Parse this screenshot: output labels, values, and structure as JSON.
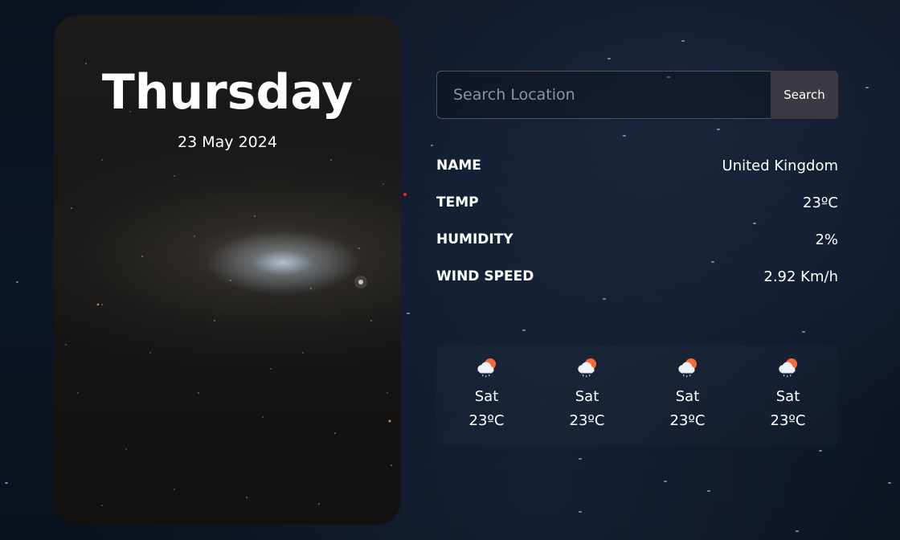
{
  "day_card": {
    "day_name": "Thursday",
    "date": "23 May 2024"
  },
  "search": {
    "placeholder": "Search Location",
    "value": "",
    "button_label": "Search"
  },
  "info": [
    {
      "label": "NAME",
      "value": "United Kingdom"
    },
    {
      "label": "TEMP",
      "value": "23ºC"
    },
    {
      "label": "HUMIDITY",
      "value": "2%"
    },
    {
      "label": "WIND SPEED",
      "value": "2.92 Km/h"
    }
  ],
  "forecast": [
    {
      "day": "Sat",
      "temp": "23ºC",
      "icon": "sun-cloud-rain-icon"
    },
    {
      "day": "Sat",
      "temp": "23ºC",
      "icon": "sun-cloud-rain-icon"
    },
    {
      "day": "Sat",
      "temp": "23ºC",
      "icon": "sun-cloud-rain-icon"
    },
    {
      "day": "Sat",
      "temp": "23ºC",
      "icon": "sun-cloud-rain-icon"
    }
  ],
  "colors": {
    "background": "#0b1220",
    "search_button": "#3b3a42",
    "text": "#ffffff",
    "sun": "#f26b3a",
    "cloud": "#e9ecf2",
    "rain": "#7fb4e8"
  }
}
